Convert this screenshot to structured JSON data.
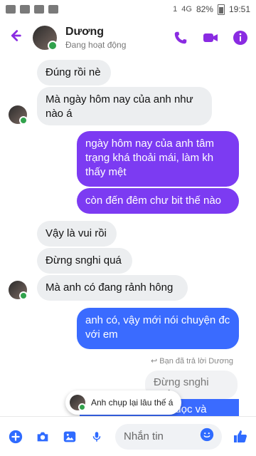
{
  "statusbar": {
    "battery": "82%",
    "time": "19:51",
    "network": "4G",
    "sim_indicator": "1"
  },
  "header": {
    "name": "Dương",
    "status": "Đang hoạt động",
    "icons": {
      "back": "back-arrow-icon",
      "call": "phone-icon",
      "video": "video-icon",
      "info": "info-icon"
    },
    "accent": "#8a2be2"
  },
  "messages": [
    {
      "from": "them",
      "text": "Đúng rồi nè"
    },
    {
      "from": "them",
      "text": "Mà ngày hôm nay của anh như nào á"
    },
    {
      "from": "me",
      "text": "ngày hôm nay của anh tâm trạng khá thoải mái, làm kh thấy mệt"
    },
    {
      "from": "me",
      "text": "còn đến đêm chư bit thế nào"
    },
    {
      "from": "them",
      "text": "Vậy là vui rồi"
    },
    {
      "from": "them",
      "text": "Đừng snghi quá"
    },
    {
      "from": "them",
      "text": "Mà anh có đang rảnh hông"
    },
    {
      "from": "me",
      "text": "anh có, vậy mới nói chuyện đc với em"
    }
  ],
  "reply": {
    "note": "Bạn đã trả lời Dương",
    "quoted": "Đừng snghi quá",
    "partial": "nếu anh vẫn đang đọc và"
  },
  "toast": {
    "text": "Anh chụp lại lâu thế á"
  },
  "composer": {
    "placeholder": "Nhắn tin",
    "icons": [
      "plus-icon",
      "camera-icon",
      "image-icon",
      "microphone-icon",
      "emoji-icon",
      "thumbs-up-icon"
    ]
  },
  "colors": {
    "in_bubble": "#eceef0",
    "out_purple": "#7c3bf2",
    "out_blue": "#3a6bff",
    "blue_icons": "#2f6bff",
    "online": "#31a24c"
  }
}
